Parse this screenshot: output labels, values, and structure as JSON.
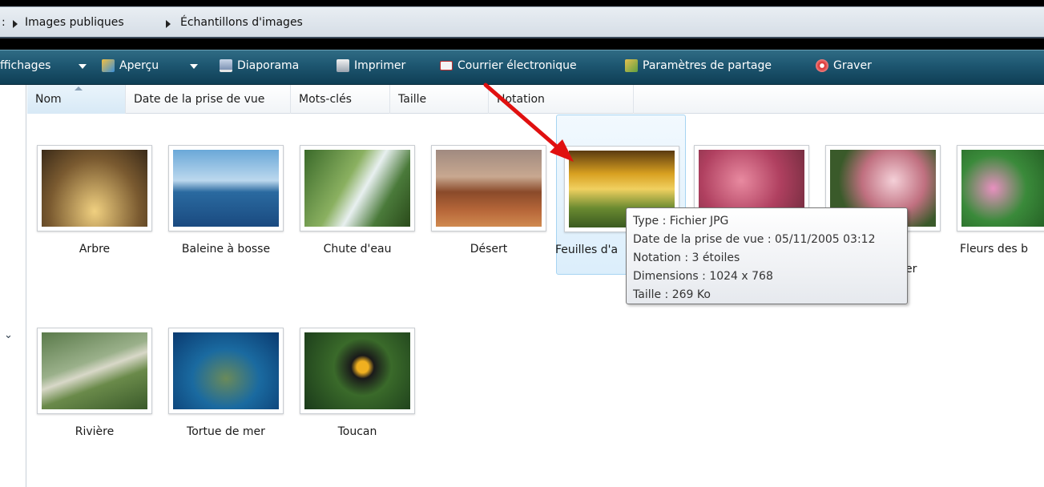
{
  "breadcrumb": {
    "prefix": ":",
    "items": [
      "Images publiques",
      "Échantillons d'images"
    ]
  },
  "toolbar": {
    "items": [
      {
        "label": "ffichages",
        "icon": "views-icon",
        "dropdown": true
      },
      {
        "label": "Aperçu",
        "icon": "preview-icon",
        "dropdown": true
      },
      {
        "label": "Diaporama",
        "icon": "slideshow-icon"
      },
      {
        "label": "Imprimer",
        "icon": "printer-icon"
      },
      {
        "label": "Courrier électronique",
        "icon": "email-icon"
      },
      {
        "label": "Paramètres de partage",
        "icon": "share-icon"
      },
      {
        "label": "Graver",
        "icon": "burn-disc-icon"
      }
    ]
  },
  "columns": [
    "Nom",
    "Date de la prise de vue",
    "Mots-clés",
    "Taille",
    "Notation"
  ],
  "files": [
    {
      "name": "Arbre"
    },
    {
      "name": "Baleine à bosse"
    },
    {
      "name": "Chute d'eau"
    },
    {
      "name": "Désert"
    },
    {
      "name": "Feuilles d'a",
      "selected": true
    },
    {
      "name": ""
    },
    {
      "name": "er"
    },
    {
      "name": "Fleurs des b"
    },
    {
      "name": "Rivière"
    },
    {
      "name": "Tortue de mer"
    },
    {
      "name": "Toucan"
    }
  ],
  "tooltip": {
    "type": "Type : Fichier JPG",
    "date": "Date de la prise de vue : 05/11/2005 03:12",
    "rating": "Notation : 3 étoiles",
    "dimensions": "Dimensions : 1024 x 768",
    "size": "Taille : 269 Ko"
  },
  "colors": {
    "toolbar": "#1d5670",
    "selection": "#dbeefb",
    "arrow": "#e01010"
  }
}
